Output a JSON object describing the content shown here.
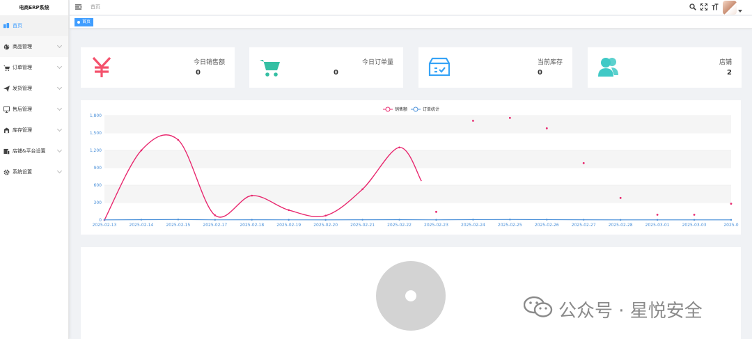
{
  "app": {
    "title": "电商ERP系统"
  },
  "sidebar": {
    "items": [
      {
        "label": "首页",
        "icon": "dashboard-icon"
      },
      {
        "label": "商品管理",
        "icon": "globe-icon"
      },
      {
        "label": "订单管理",
        "icon": "cart-icon"
      },
      {
        "label": "发货管理",
        "icon": "send-icon"
      },
      {
        "label": "售后管理",
        "icon": "monitor-icon"
      },
      {
        "label": "库存管理",
        "icon": "inventory-icon"
      },
      {
        "label": "店铺&平台设置",
        "icon": "shop-icon"
      },
      {
        "label": "系统设置",
        "icon": "gear-icon"
      }
    ]
  },
  "header": {
    "breadcrumb": "首页"
  },
  "tags": {
    "home": "首页"
  },
  "stats": [
    {
      "label": "今日销售额",
      "value": "0",
      "icon": "yen-icon",
      "color": "#f4516c"
    },
    {
      "label": "今日订单量",
      "value": "0",
      "icon": "cart-icon",
      "color": "#34bfa3"
    },
    {
      "label": "当前库存",
      "value": "0",
      "icon": "box-check-icon",
      "color": "#36a3f7"
    },
    {
      "label": "店铺",
      "value": "2",
      "icon": "people-icon",
      "color": "#40c9c6"
    }
  ],
  "chart_data": {
    "type": "line",
    "categories": [
      "2025-02-13",
      "2025-02-14",
      "2025-02-15",
      "2025-02-17",
      "2025-02-18",
      "2025-02-19",
      "2025-02-20",
      "2025-02-21",
      "2025-02-22",
      "2025-02-23",
      "2025-02-24",
      "2025-02-25",
      "2025-02-26",
      "2025-02-27",
      "2025-02-28",
      "2025-03-01",
      "2025-03-03",
      "2025-0"
    ],
    "ylim": [
      0,
      1800
    ],
    "yticks": [
      "0",
      "300",
      "600",
      "900",
      "1,200",
      "1,500",
      "1,800"
    ],
    "series": [
      {
        "name": "销售额",
        "color": "#e8296f",
        "line_values": [
          0,
          1200,
          1380,
          80,
          420,
          170,
          75,
          530,
          1250
        ],
        "line_end_value": 670,
        "scatter_values": [
          140,
          1710,
          1760,
          1580,
          980,
          380,
          90,
          90,
          280
        ]
      },
      {
        "name": "订单统计",
        "color": "#4a90d9",
        "values": [
          2,
          5,
          8,
          3,
          4,
          3,
          2,
          4,
          5,
          3,
          6,
          8,
          6,
          4,
          2,
          2,
          2,
          2
        ]
      }
    ],
    "grid": true,
    "legend": "top-center"
  },
  "watermark": {
    "text": "公众号 · 星悦安全"
  }
}
